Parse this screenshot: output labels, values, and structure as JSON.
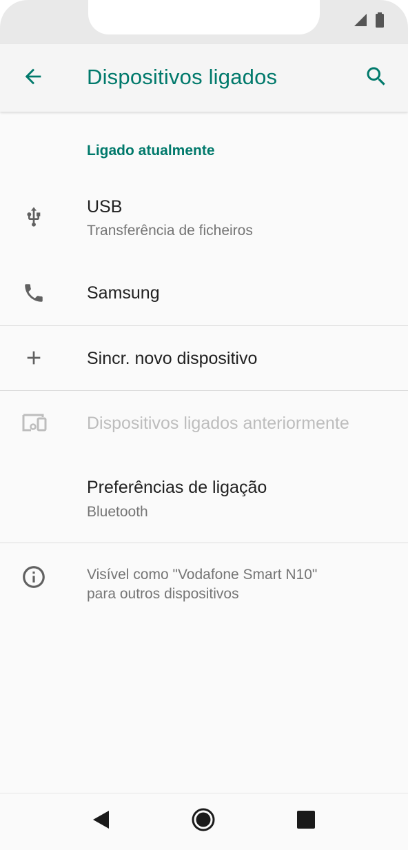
{
  "toolbar": {
    "title": "Dispositivos ligados",
    "back_icon": "arrow-back-icon",
    "search_icon": "search-icon"
  },
  "section": {
    "header": "Ligado atualmente"
  },
  "items": [
    {
      "icon": "usb-icon",
      "title": "USB",
      "subtitle": "Transferência de ficheiros"
    },
    {
      "icon": "phone-icon",
      "title": "Samsung"
    },
    {
      "icon": "plus-icon",
      "title": "Sincr. novo dispositivo"
    },
    {
      "icon": "devices-icon",
      "title": "Dispositivos ligados anteriormente",
      "disabled": true
    },
    {
      "title": "Preferências de ligação",
      "subtitle": "Bluetooth"
    }
  ],
  "info": {
    "icon": "info-icon",
    "text_line1": "Visível como \"Vodafone Smart N10\"",
    "text_line2": "para outros dispositivos"
  },
  "colors": {
    "accent": "#00796b",
    "disabled": "#bdbdbd"
  }
}
